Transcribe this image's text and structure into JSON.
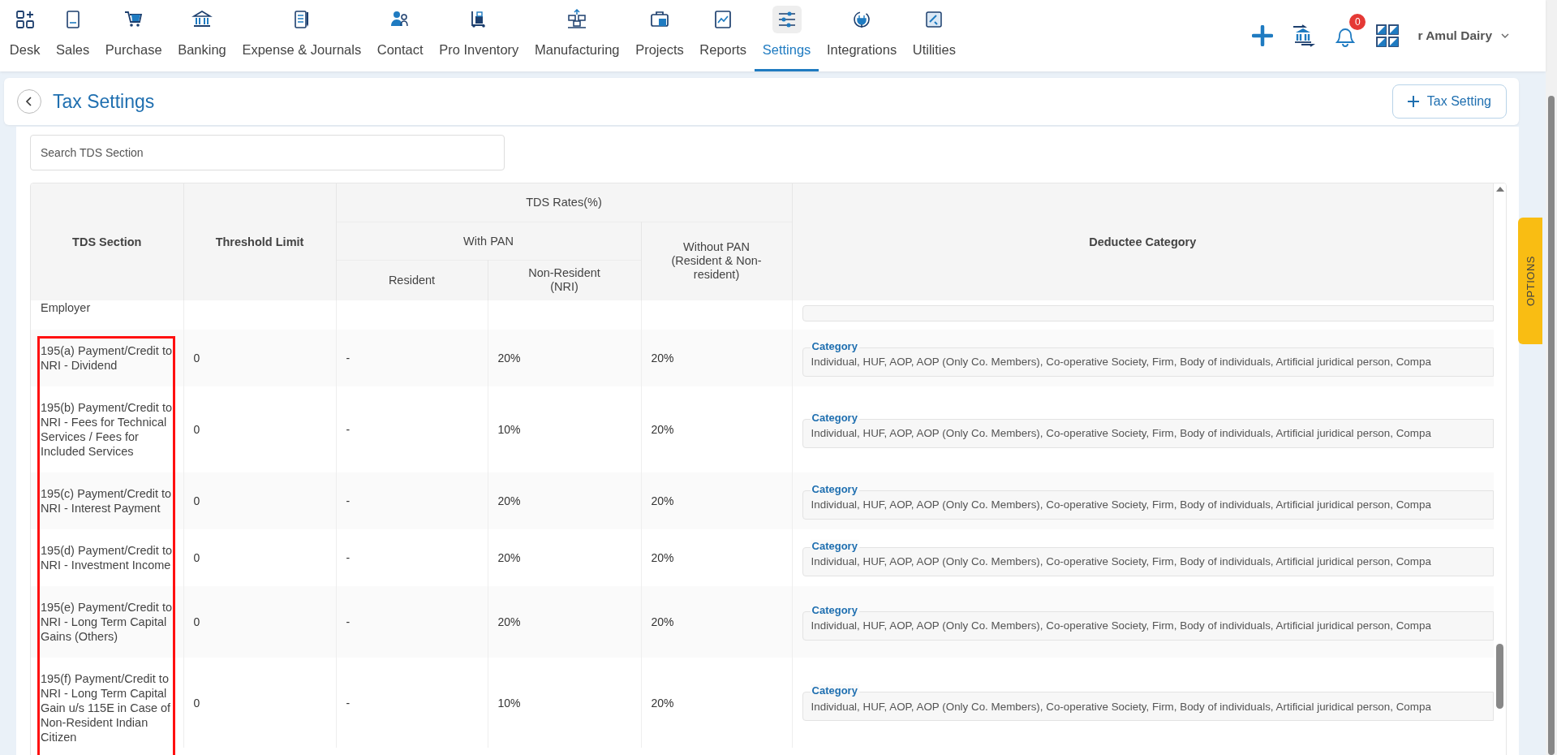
{
  "nav": {
    "items": [
      {
        "label": "Desk",
        "selected": false
      },
      {
        "label": "Sales",
        "selected": false
      },
      {
        "label": "Purchase",
        "selected": false
      },
      {
        "label": "Banking",
        "selected": false
      },
      {
        "label": "Expense & Journals",
        "selected": false
      },
      {
        "label": "Contact",
        "selected": false
      },
      {
        "label": "Pro Inventory",
        "selected": false
      },
      {
        "label": "Manufacturing",
        "selected": false
      },
      {
        "label": "Projects",
        "selected": false
      },
      {
        "label": "Reports",
        "selected": false
      },
      {
        "label": "Settings",
        "selected": true
      },
      {
        "label": "Integrations",
        "selected": false
      },
      {
        "label": "Utilities",
        "selected": false
      }
    ],
    "notifications": "0",
    "company": "r Amul Dairy"
  },
  "header": {
    "title": "Tax Settings",
    "add_button": "Tax Setting"
  },
  "search": {
    "placeholder": "Search TDS Section"
  },
  "table": {
    "headers": {
      "section": "TDS Section",
      "threshold": "Threshold Limit",
      "rates": "TDS Rates(%)",
      "with_pan": "With PAN",
      "resident": "Resident",
      "nri": "Non-Resident (NRI)",
      "without_pan": "Without PAN (Resident & Non-resident)",
      "category": "Deductee Category"
    },
    "rows": [
      {
        "kind": "partial",
        "section": "Employer"
      },
      {
        "kind": "full",
        "section": "195(a) Payment/Credit to NRI - Dividend",
        "threshold": "0",
        "resident": "-",
        "nri": "20%",
        "without_pan": "20%",
        "category_label": "Category",
        "category": "Individual, HUF, AOP, AOP (Only Co. Members), Co-operative Society, Firm, Body of individuals, Artificial juridical person, Compa"
      },
      {
        "kind": "full",
        "section": "195(b) Payment/Credit to NRI - Fees for Technical Services / Fees for Included Services",
        "threshold": "0",
        "resident": "-",
        "nri": "10%",
        "without_pan": "20%",
        "category_label": "Category",
        "category": "Individual, HUF, AOP, AOP (Only Co. Members), Co-operative Society, Firm, Body of individuals, Artificial juridical person, Compa"
      },
      {
        "kind": "full",
        "section": "195(c) Payment/Credit to NRI - Interest Payment",
        "threshold": "0",
        "resident": "-",
        "nri": "20%",
        "without_pan": "20%",
        "category_label": "Category",
        "category": "Individual, HUF, AOP, AOP (Only Co. Members), Co-operative Society, Firm, Body of individuals, Artificial juridical person, Compa"
      },
      {
        "kind": "full",
        "section": "195(d) Payment/Credit to NRI - Investment Income",
        "threshold": "0",
        "resident": "-",
        "nri": "20%",
        "without_pan": "20%",
        "category_label": "Category",
        "category": "Individual, HUF, AOP, AOP (Only Co. Members), Co-operative Society, Firm, Body of individuals, Artificial juridical person, Compa"
      },
      {
        "kind": "full",
        "section": "195(e) Payment/Credit to NRI - Long Term Capital Gains (Others)",
        "threshold": "0",
        "resident": "-",
        "nri": "20%",
        "without_pan": "20%",
        "category_label": "Category",
        "category": "Individual, HUF, AOP, AOP (Only Co. Members), Co-operative Society, Firm, Body of individuals, Artificial juridical person, Compa"
      },
      {
        "kind": "full",
        "section": "195(f) Payment/Credit to NRI - Long Term Capital Gain u/s 115E in Case of Non-Resident Indian Citizen",
        "threshold": "0",
        "resident": "-",
        "nri": "10%",
        "without_pan": "20%",
        "category_label": "Category",
        "category": "Individual, HUF, AOP, AOP (Only Co. Members), Co-operative Society, Firm, Body of individuals, Artificial juridical person, Compa"
      }
    ]
  },
  "options_tab": "OPTIONS"
}
